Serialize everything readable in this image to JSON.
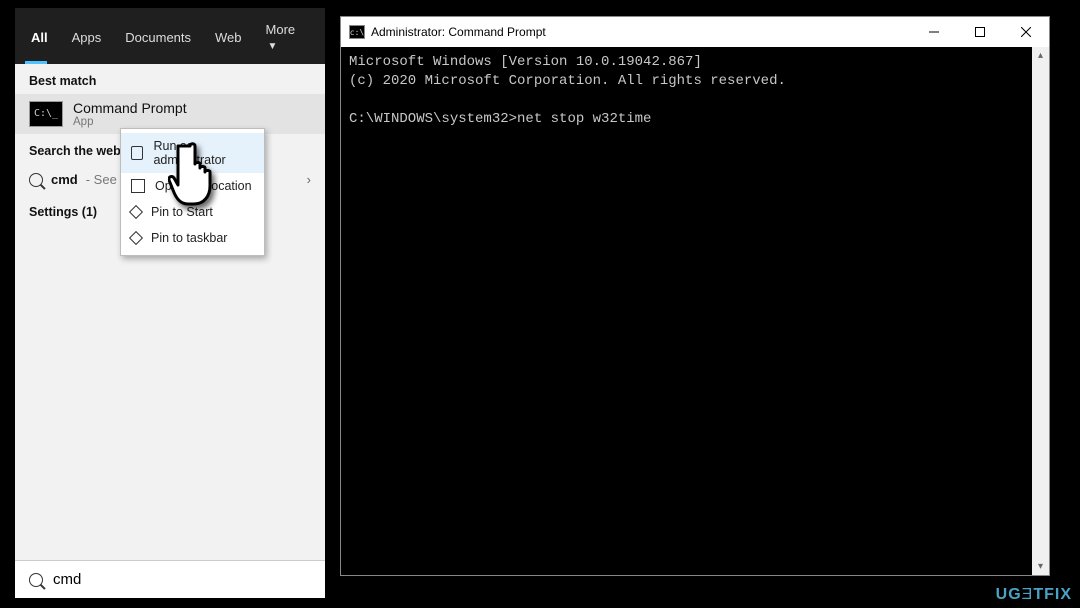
{
  "search": {
    "tabs": {
      "all": "All",
      "apps": "Apps",
      "documents": "Documents",
      "web": "Web",
      "more": "More"
    },
    "sections": {
      "best_match": "Best match",
      "search_web": "Search the web",
      "settings": "Settings (1)"
    },
    "best_match": {
      "title": "Command Prompt",
      "subtitle": "App"
    },
    "web_row": {
      "query": "cmd",
      "suffix": "- See w"
    },
    "input_value": "cmd"
  },
  "context_menu": {
    "items": [
      {
        "label": "Run as administrator",
        "icon": "shield-icon"
      },
      {
        "label": "Open file location",
        "icon": "folder-icon"
      },
      {
        "label": "Pin to Start",
        "icon": "pin-icon"
      },
      {
        "label": "Pin to taskbar",
        "icon": "pin-icon"
      }
    ]
  },
  "cmd": {
    "title": "Administrator: Command Prompt",
    "line1": "Microsoft Windows [Version 10.0.19042.867]",
    "line2": "(c) 2020 Microsoft Corporation. All rights reserved.",
    "prompt_path": "C:\\WINDOWS\\system32>",
    "typed_command": "net stop w32time"
  },
  "watermark": "UGETFIX"
}
